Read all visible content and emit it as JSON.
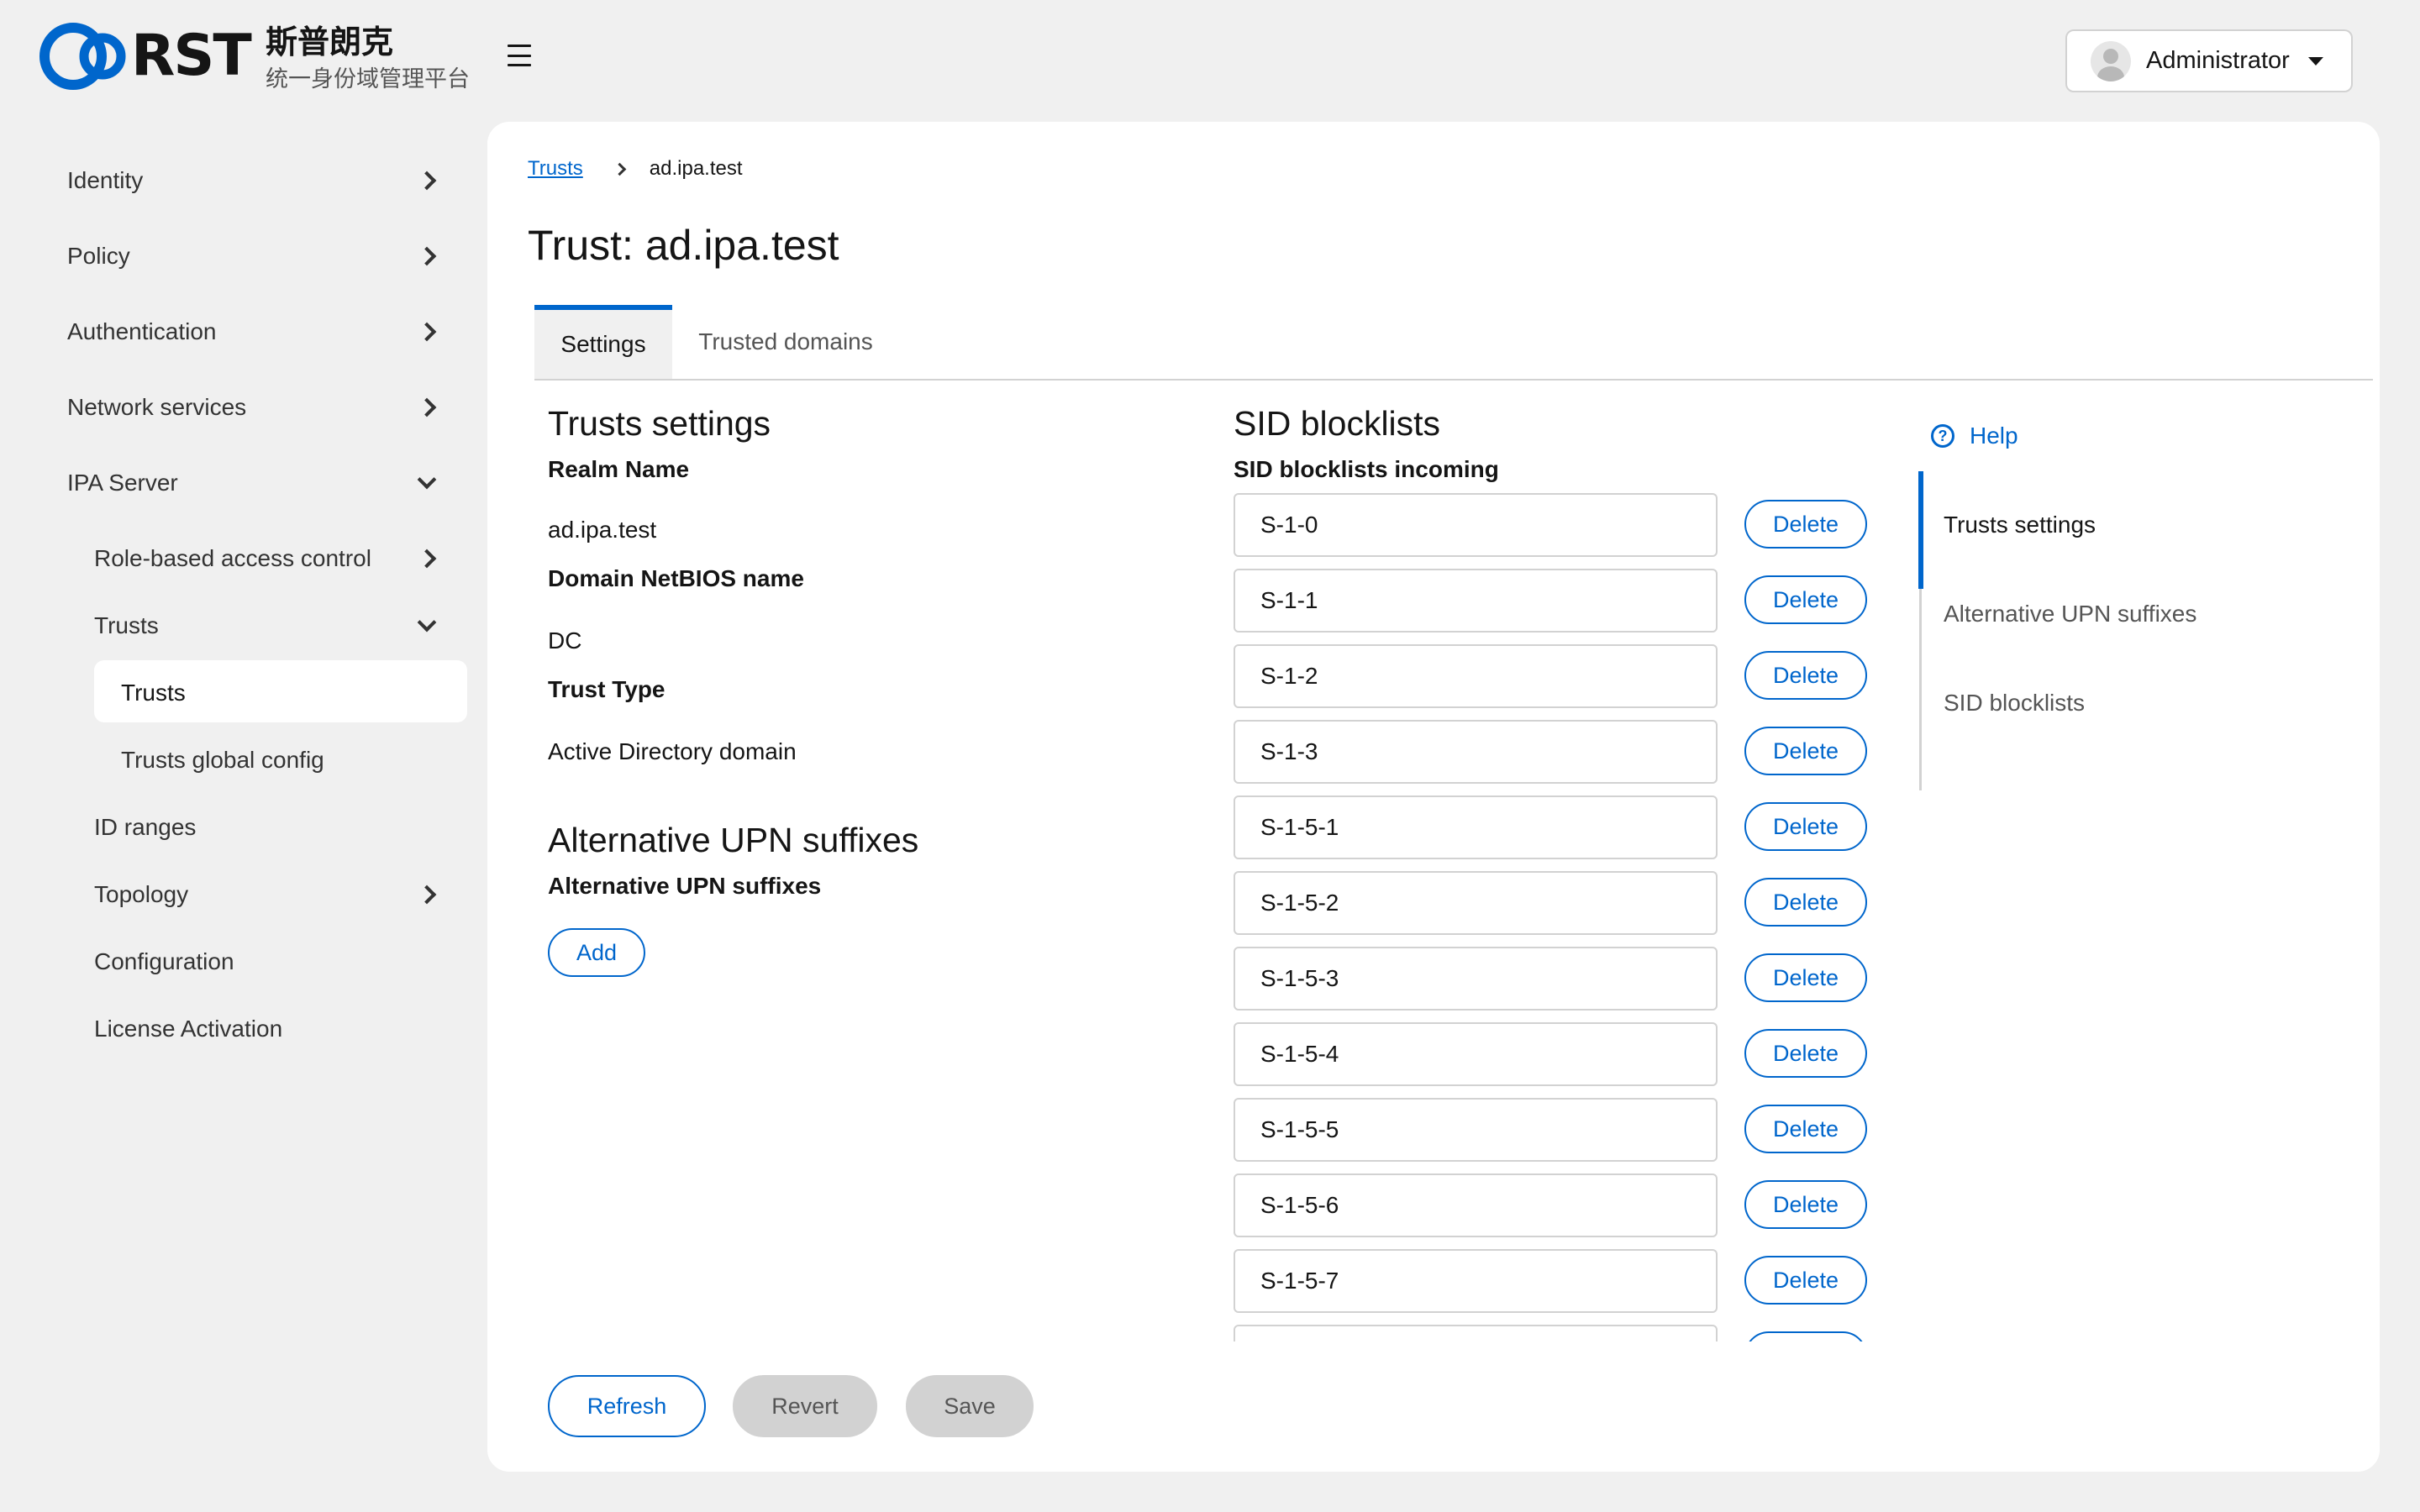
{
  "brand": {
    "logo_text": "RST",
    "name": "斯普朗克",
    "subtitle": "统一身份域管理平台",
    "accent_color": "#0066cc"
  },
  "header": {
    "menu_icon": "hamburger-icon",
    "user": {
      "name": "Administrator",
      "avatar_icon": "user-avatar-icon",
      "caret_icon": "caret-down-icon"
    }
  },
  "sidebar": {
    "items": [
      {
        "label": "Identity",
        "chevron": "right"
      },
      {
        "label": "Policy",
        "chevron": "right"
      },
      {
        "label": "Authentication",
        "chevron": "right"
      },
      {
        "label": "Network services",
        "chevron": "right"
      },
      {
        "label": "IPA Server",
        "chevron": "down"
      }
    ],
    "ipa_server": {
      "role_based_access_control": "Role-based access control",
      "trusts": "Trusts",
      "trusts_children": {
        "trusts": "Trusts",
        "trusts_global_config": "Trusts global config"
      },
      "id_ranges": "ID ranges",
      "topology": "Topology",
      "configuration": "Configuration",
      "license_activation": "License Activation"
    }
  },
  "breadcrumb": {
    "parent": "Trusts",
    "current": "ad.ipa.test"
  },
  "page": {
    "title": "Trust: ad.ipa.test",
    "tabs": [
      {
        "label": "Settings",
        "active": true
      },
      {
        "label": "Trusted domains",
        "active": false
      }
    ]
  },
  "trust_settings": {
    "title": "Trusts settings",
    "realm_name_label": "Realm Name",
    "realm_name_value": "ad.ipa.test",
    "netbios_label": "Domain NetBIOS name",
    "netbios_value": "DC",
    "trust_type_label": "Trust Type",
    "trust_type_value": "Active Directory domain"
  },
  "upn": {
    "title": "Alternative UPN suffixes",
    "label": "Alternative UPN suffixes",
    "add_label": "Add"
  },
  "sid": {
    "title": "SID blocklists",
    "incoming_label": "SID blocklists incoming",
    "delete_label": "Delete",
    "values": [
      "S-1-0",
      "S-1-1",
      "S-1-2",
      "S-1-3",
      "S-1-5-1",
      "S-1-5-2",
      "S-1-5-3",
      "S-1-5-4",
      "S-1-5-5",
      "S-1-5-6",
      "S-1-5-7",
      ""
    ]
  },
  "help_panel": {
    "help_label": "Help",
    "links": [
      "Trusts settings",
      "Alternative UPN suffixes",
      "SID blocklists"
    ]
  },
  "footer": {
    "refresh": "Refresh",
    "revert": "Revert",
    "save": "Save"
  }
}
